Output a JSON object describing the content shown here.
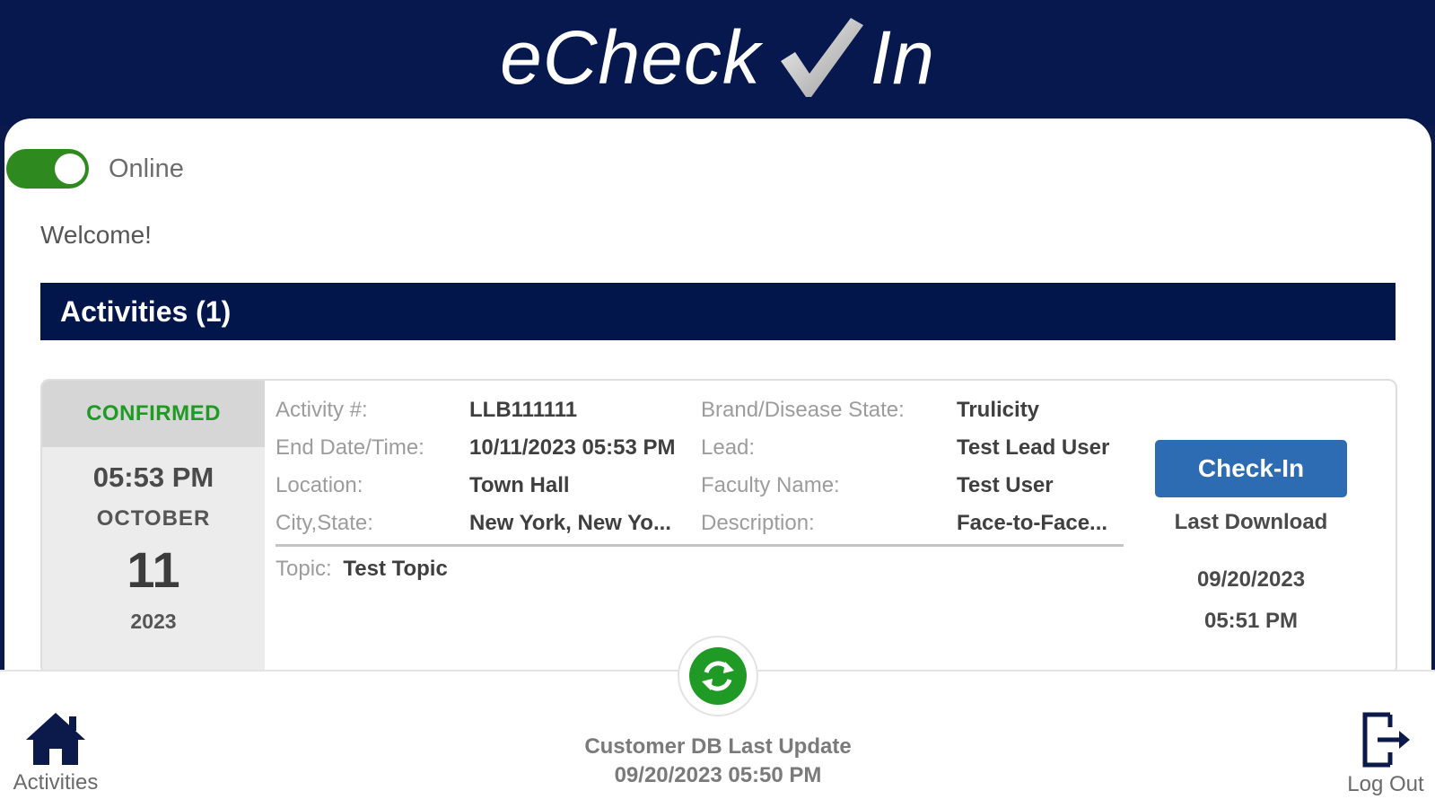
{
  "header": {
    "brand_left": "eCheck",
    "brand_right": "In",
    "brand_check": "✓"
  },
  "status_toggle": {
    "label": "Online",
    "on": true
  },
  "welcome": "Welcome!",
  "activities_header": "Activities (1)",
  "activity": {
    "status": "CONFIRMED",
    "time": "05:53 PM",
    "month": "OCTOBER",
    "day": "11",
    "year": "2023",
    "fields": {
      "activity_label": "Activity #:",
      "activity_value": "LLB111111",
      "end_label": "End Date/Time:",
      "end_value": "10/11/2023 05:53 PM",
      "location_label": "Location:",
      "location_value": "Town Hall",
      "city_label": "City,State:",
      "city_value": "New York, New Yo...",
      "brand_label": "Brand/Disease State:",
      "brand_value": "Trulicity",
      "lead_label": "Lead:",
      "lead_value": "Test Lead User",
      "faculty_label": "Faculty Name:",
      "faculty_value": "Test User",
      "description_label": "Description:",
      "description_value": "Face-to-Face...",
      "topic_label": "Topic:",
      "topic_value": "Test Topic"
    },
    "checkin_label": "Check-In",
    "last_download_label": "Last Download",
    "last_download_date": "09/20/2023",
    "last_download_time": "05:51 PM"
  },
  "footer": {
    "db_update_line1": "Customer DB Last Update",
    "db_update_line2": "09/20/2023 05:50 PM",
    "nav_activities": "Activities",
    "nav_logout": "Log Out"
  },
  "colors": {
    "navy": "#06184d",
    "toggle_green": "#2e8a1f",
    "confirmed_green": "#1f9a25",
    "button_blue": "#2d6bb2",
    "sync_green": "#1f9a25"
  },
  "icons": [
    "checkmark-icon",
    "sync-icon",
    "home-icon",
    "logout-icon"
  ]
}
